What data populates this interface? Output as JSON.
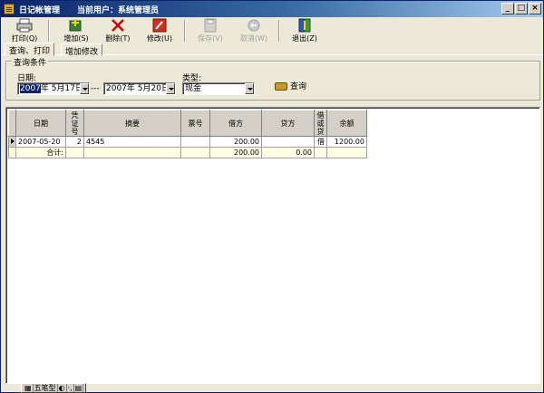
{
  "window": {
    "title": "日记帐管理",
    "user_text": "当前用户：系统管理员",
    "min_label": "_",
    "max_label": "□",
    "close_label": "×"
  },
  "toolbar": {
    "print": "打印(Q)",
    "add": "增加(S)",
    "delete": "删除(T)",
    "edit": "修改(U)",
    "save": "保存(V)",
    "cancel": "取消(W)",
    "exit": "退出(Z)"
  },
  "tabs": [
    "查询、打印",
    "增加修改"
  ],
  "query": {
    "group_label": "查询条件",
    "date_label": "日期:",
    "date_from_year": "2007",
    "date_from_rest": "年  5月17日",
    "date_sep": "---",
    "date_to": "2007年  5月20日",
    "type_label": "类型:",
    "type_value": "现金",
    "query_button": "查询"
  },
  "table": {
    "headers": {
      "date": "日期",
      "voucher": "凭证号",
      "summary": "摘要",
      "ticket": "票号",
      "debit": "借方",
      "credit": "贷方",
      "dc": "借或贷",
      "balance": "余额"
    },
    "rows": [
      {
        "date": "2007-05-20",
        "voucher": "2",
        "summary": "4545",
        "ticket": "",
        "debit": "200.00",
        "credit": "",
        "dc": "借",
        "balance": "1200.00"
      }
    ],
    "total": {
      "date": "合计:",
      "debit": "200.00",
      "credit": "0.00"
    }
  },
  "ime": {
    "mode": "五笔型"
  }
}
